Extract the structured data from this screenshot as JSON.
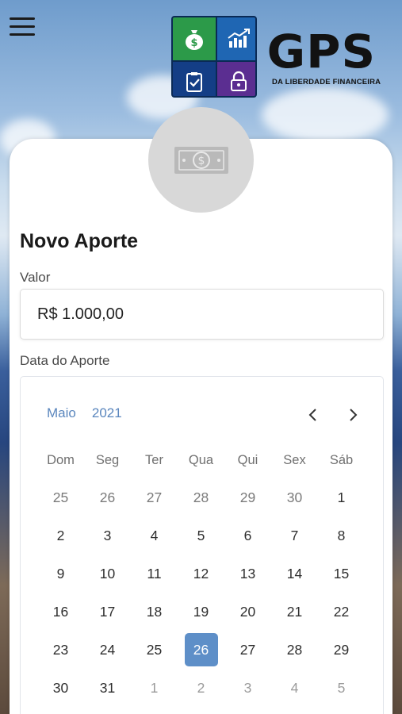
{
  "header": {
    "menu_icon": "hamburger-menu-icon",
    "brand_name": "GPS",
    "brand_tagline": "DA LIBERDADE FINANCEIRA",
    "logo_icons": [
      "money-bag-icon",
      "growth-chart-icon",
      "checklist-icon",
      "padlock-icon"
    ],
    "logo_colors": [
      "#2c9a49",
      "#1f66b3",
      "#143e86",
      "#5b2e91"
    ]
  },
  "form": {
    "avatar_icon": "banknote-icon",
    "title": "Novo Aporte",
    "valor_label": "Valor",
    "valor_value": "R$ 1.000,00",
    "data_label": "Data do Aporte"
  },
  "calendar": {
    "month": "Maio",
    "year": "2021",
    "prev_icon": "chevron-left-icon",
    "next_icon": "chevron-right-icon",
    "accent_color": "#5e8fc8",
    "weekdays": [
      "Dom",
      "Seg",
      "Ter",
      "Qua",
      "Qui",
      "Sex",
      "Sáb"
    ],
    "weeks": [
      [
        "25",
        "26",
        "27",
        "28",
        "29",
        "30",
        "1"
      ],
      [
        "2",
        "3",
        "4",
        "5",
        "6",
        "7",
        "8"
      ],
      [
        "9",
        "10",
        "11",
        "12",
        "13",
        "14",
        "15"
      ],
      [
        "16",
        "17",
        "18",
        "19",
        "20",
        "21",
        "22"
      ],
      [
        "23",
        "24",
        "25",
        "26",
        "27",
        "28",
        "29"
      ],
      [
        "30",
        "31",
        "1",
        "2",
        "3",
        "4",
        "5"
      ]
    ],
    "selected_day": "26"
  }
}
